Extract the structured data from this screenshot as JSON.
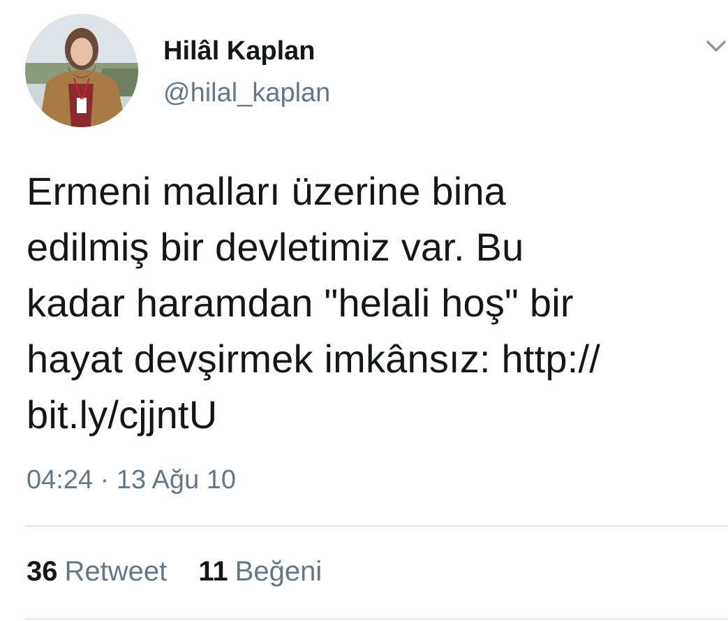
{
  "author": {
    "display_name": "Hilâl Kaplan",
    "handle": "@hilal_kaplan",
    "avatar_icon": "profile-photo"
  },
  "tweet": {
    "lines": [
      "Ermeni malları üzerine bina",
      "edilmiş bir devletimiz var. Bu",
      "kadar haramdan \"helali hoş\" bir",
      "hayat devşirmek imkânsız: http://",
      "bit.ly/cjjntU"
    ],
    "timestamp": "04:24 · 13 Ağu 10"
  },
  "stats": {
    "retweets": {
      "count": "36",
      "label": "Retweet"
    },
    "likes": {
      "count": "11",
      "label": "Beğeni"
    }
  },
  "colors": {
    "text": "#14171a",
    "secondary": "#657786",
    "divider": "#e1e8ed",
    "background": "#ffffff"
  }
}
